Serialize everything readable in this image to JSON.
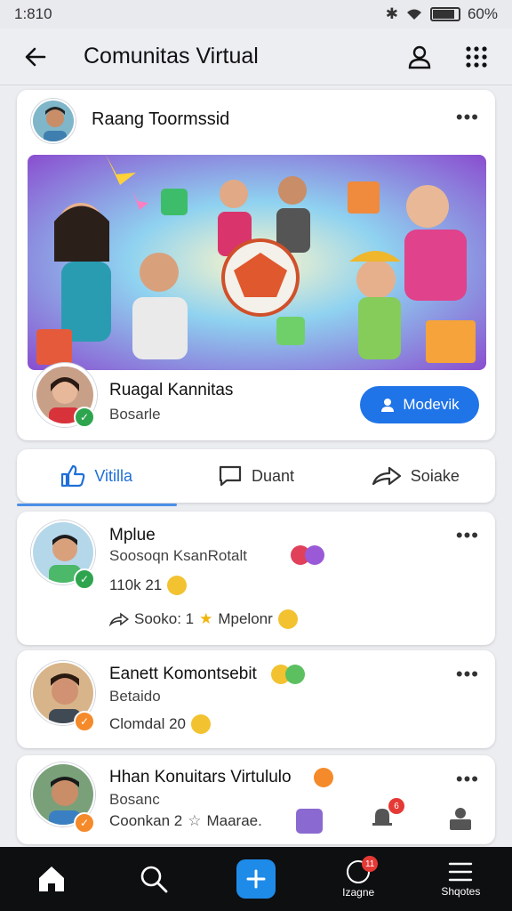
{
  "status_bar": {
    "time": "1:810",
    "battery": "60%"
  },
  "app_bar": {
    "title": "Comunitas Virtual"
  },
  "post": {
    "author": "Raang Toormssid",
    "community_name": "Ruagal Kannitas",
    "community_sub": "Bosarle",
    "join_label": "Modevik"
  },
  "actions": {
    "like": "Vitilla",
    "comment": "Duant",
    "share": "Soiake"
  },
  "feed": [
    {
      "name": "Mplue",
      "subtitle": "Soosoqn KsanRotalt",
      "stat": "110k  21",
      "footer": "Sooko:   1",
      "footer2": "Mpelonr"
    },
    {
      "name": "Eanett Komontsebit",
      "subtitle": "Betaido",
      "stat": "Clomdal   20"
    },
    {
      "name": "Hhan Konuitars Virtululo",
      "subtitle": "Bosanc",
      "stat": "Coonkan   2",
      "footer2": "Maarae."
    }
  ],
  "bottom_nav": {
    "notif_count": "11",
    "notif_label": "Izagne",
    "menu_label": "Shqotes",
    "comment_badge": "6"
  },
  "colors": {
    "accent": "#1f74e8",
    "badge_green": "#2ea44f",
    "badge_orange": "#f58a2a",
    "nav_bg": "#0e0f11"
  }
}
